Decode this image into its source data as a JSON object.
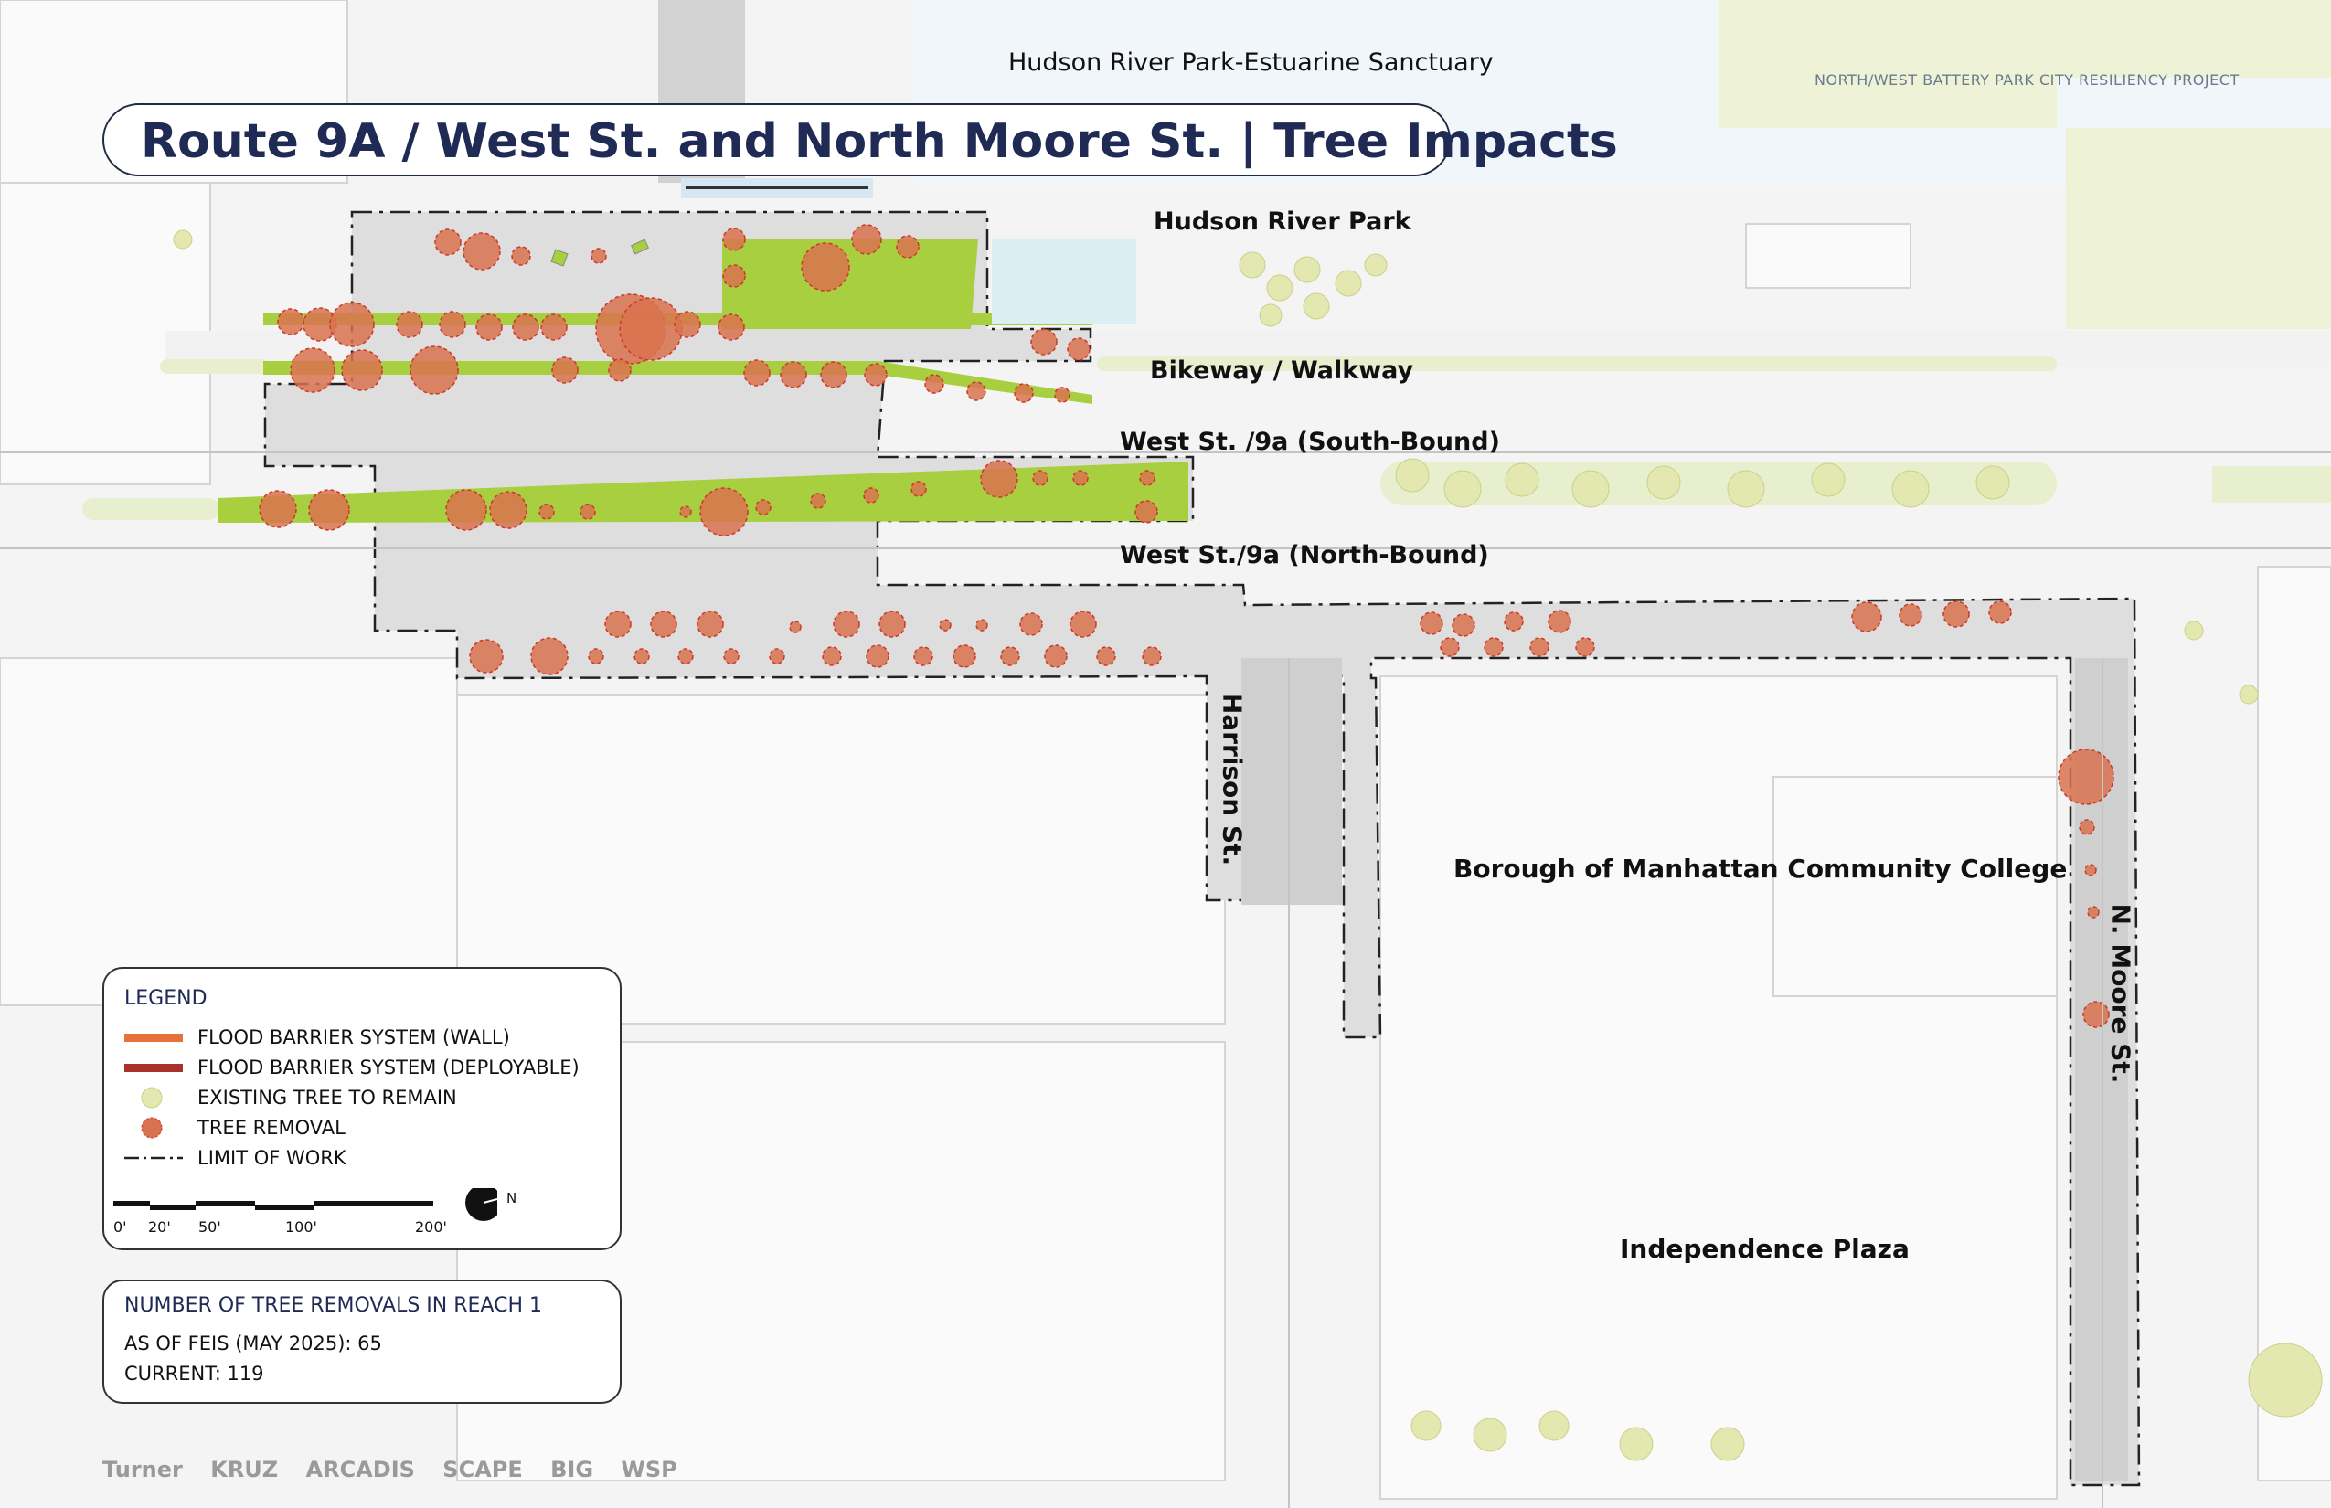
{
  "title": "Route 9A / West St. and North Moore St. | Tree Impacts",
  "project_name": "NORTH/WEST BATTERY PARK CITY RESILIENCY PROJECT",
  "labels": {
    "sanctuary": "Hudson River Park-Estuarine Sanctuary",
    "park": "Hudson River Park",
    "bikeway": "Bikeway /  Walkway",
    "south_bound": "West St. /9a (South-Bound)",
    "north_bound": "West St./9a (North-Bound)",
    "harrison": "Harrison St.",
    "bmcc": "Borough of Manhattan Community College",
    "n_moore": "N. Moore St.",
    "independence": "Independence Plaza"
  },
  "legend": {
    "title": "LEGEND",
    "items": [
      {
        "label": "FLOOD BARRIER SYSTEM (WALL)",
        "icon": "wall-line",
        "color": "#e8713a"
      },
      {
        "label": "FLOOD BARRIER SYSTEM (DEPLOYABLE)",
        "icon": "deployable-line",
        "color": "#a8322a"
      },
      {
        "label": "EXISTING TREE TO REMAIN",
        "icon": "tree-remain-circle",
        "color": "#e3e8b0"
      },
      {
        "label": "TREE REMOVAL",
        "icon": "tree-removal-circle",
        "color": "#d9734f"
      },
      {
        "label": "LIMIT OF WORK",
        "icon": "limit-dashdot-line",
        "color": "#222222"
      }
    ]
  },
  "scale_bar": {
    "ticks": [
      "0'",
      "20'",
      "50'",
      "100'",
      "200'"
    ],
    "north": "N"
  },
  "tree_count": {
    "title": "NUMBER OF TREE REMOVALS IN REACH 1",
    "as_of": "AS OF FEIS (MAY 2025): 65",
    "current": "CURRENT: 119"
  },
  "logos": [
    "Turner",
    "KRUZ",
    "ARCADIS",
    "SCAPE",
    "BIG",
    "WSP"
  ],
  "colors": {
    "water": "#f1f6fb",
    "work_area": "#dedede",
    "median_green": "#a8cf3f",
    "tree_removal": "#d9734f",
    "tree_remain": "#e3e8b0",
    "park_green": "#e7efcf",
    "title_navy": "#1f2a55"
  }
}
